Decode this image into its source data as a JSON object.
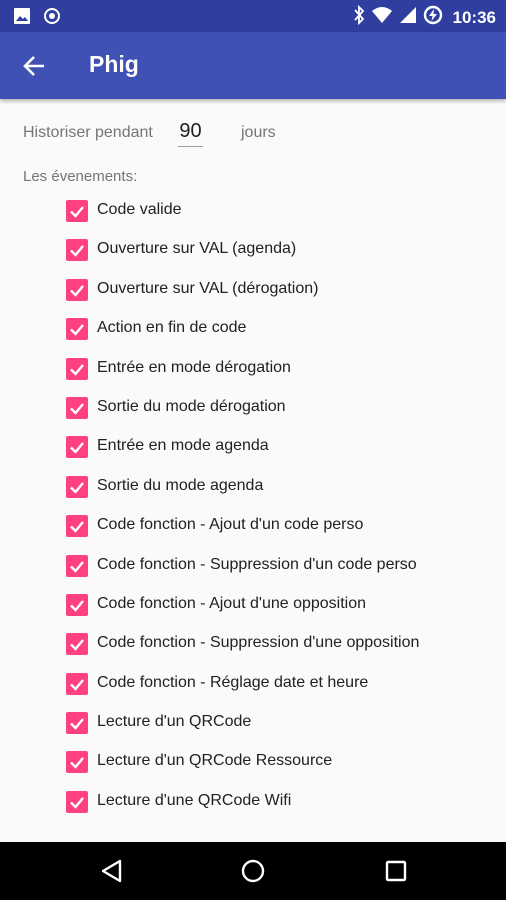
{
  "status_bar": {
    "time": "10:36",
    "left_icons": [
      "image-icon",
      "record-icon"
    ],
    "right_icons": [
      "bluetooth-icon",
      "wifi-icon",
      "signal-icon",
      "battery-charging-icon"
    ]
  },
  "app_bar": {
    "title": "Phig",
    "back_icon": "arrow-back-icon",
    "background": "#3f51b5"
  },
  "history": {
    "label": "Historiser pendant",
    "days_value": "90",
    "days_unit": "jours"
  },
  "events": {
    "label": "Les évenements:",
    "accent_color": "#ff4081",
    "items": [
      {
        "label": "Code valide",
        "checked": true
      },
      {
        "label": "Ouverture sur VAL (agenda)",
        "checked": true
      },
      {
        "label": "Ouverture sur VAL (dérogation)",
        "checked": true
      },
      {
        "label": "Action en fin de code",
        "checked": true
      },
      {
        "label": "Entrée en mode dérogation",
        "checked": true
      },
      {
        "label": "Sortie du mode dérogation",
        "checked": true
      },
      {
        "label": "Entrée en mode agenda",
        "checked": true
      },
      {
        "label": "Sortie du mode agenda",
        "checked": true
      },
      {
        "label": "Code fonction - Ajout d'un code perso",
        "checked": true
      },
      {
        "label": "Code fonction - Suppression d'un code perso",
        "checked": true
      },
      {
        "label": "Code fonction - Ajout d'une opposition",
        "checked": true
      },
      {
        "label": "Code fonction - Suppression d'une opposition",
        "checked": true
      },
      {
        "label": "Code fonction - Réglage date et heure",
        "checked": true
      },
      {
        "label": "Lecture d'un QRCode",
        "checked": true
      },
      {
        "label": "Lecture d'un QRCode Ressource",
        "checked": true
      },
      {
        "label": "Lecture d'une QRCode Wifi",
        "checked": true
      }
    ]
  },
  "nav_bar": {
    "buttons": [
      "back-triangle-icon",
      "home-circle-icon",
      "recents-square-icon"
    ]
  }
}
